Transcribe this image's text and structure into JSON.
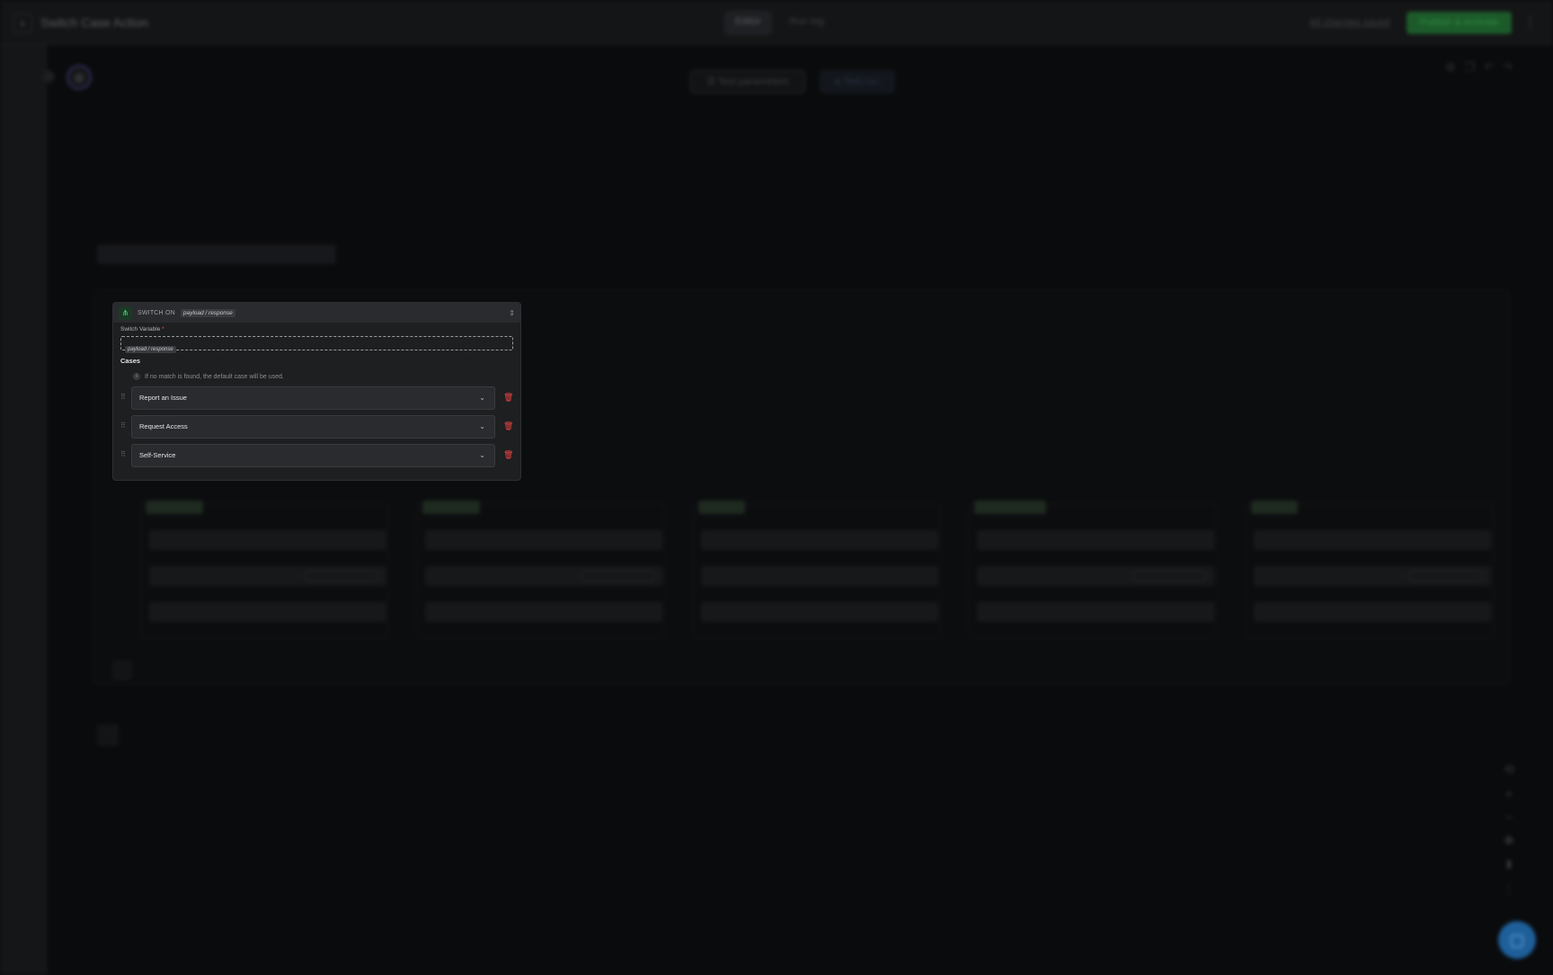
{
  "header": {
    "title": "Switch Case Action",
    "tabs": [
      {
        "label": "Editor"
      },
      {
        "label": "Run log"
      }
    ],
    "saved_status": "All changes saved",
    "publish_label": "Publish & Activate"
  },
  "toolbar": {
    "test_parameters_label": "Test parameters",
    "test_run_label": "Test run"
  },
  "switch": {
    "title": "SWITCH ON",
    "variable_pill": "payload / response",
    "variable_label": "Switch Variable",
    "required_mark": "*",
    "input_pill": "payload / response",
    "cases_title": "Cases",
    "info_text": "If no match is found, the default case will be used.",
    "cases": [
      {
        "label": "Report an Issue"
      },
      {
        "label": "Request Access"
      },
      {
        "label": "Self-Service"
      }
    ]
  },
  "colors": {
    "accent_green": "#4ade80",
    "publish_green": "#22c55e",
    "delete_red": "#ef4444",
    "chat_blue": "#2563eb"
  },
  "icons": {
    "back": "chevron-left-icon",
    "kebab": "more-vertical-icon",
    "switch": "branch-icon",
    "drag": "drag-handle-icon",
    "chevron": "chevron-down-icon",
    "trash": "trash-icon",
    "info": "info-icon",
    "chat": "chat-icon"
  }
}
